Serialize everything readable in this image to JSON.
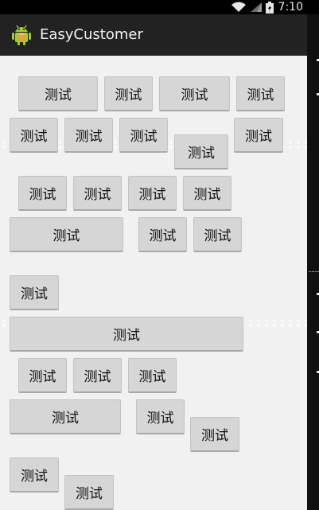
{
  "status_bar": {
    "time": "7:10",
    "icons": [
      "wifi-icon",
      "signal-icon",
      "battery-icon"
    ]
  },
  "action_bar": {
    "title": "EasyCustomer",
    "icon": "android-robot-icon"
  },
  "buttons": {
    "label": "测试"
  }
}
